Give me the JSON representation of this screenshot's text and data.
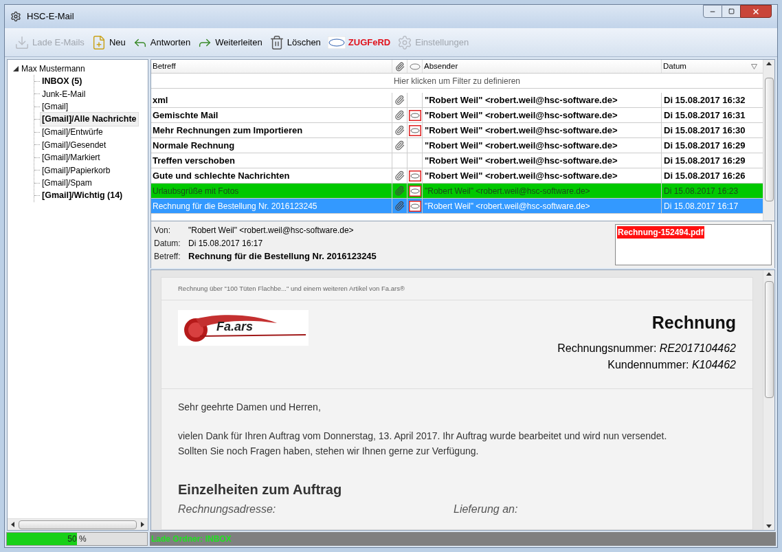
{
  "window": {
    "title": "HSC-E-Mail"
  },
  "toolbar": [
    {
      "label": "Lade E-Mails",
      "kind": "download",
      "disabled": true
    },
    {
      "label": "Neu",
      "kind": "new",
      "disabled": false
    },
    {
      "label": "Antworten",
      "kind": "reply",
      "disabled": false
    },
    {
      "label": "Weiterleiten",
      "kind": "forward",
      "disabled": false
    },
    {
      "label": "Löschen",
      "kind": "trash",
      "disabled": false
    },
    {
      "label": "ZUGFeRD",
      "kind": "ferd",
      "disabled": false
    },
    {
      "label": "Einstellungen",
      "kind": "settings",
      "disabled": true
    }
  ],
  "folders": {
    "label": "Max Mustermann",
    "expanded": true,
    "children": [
      {
        "label": "INBOX (5)",
        "bold": true,
        "selected": false
      },
      {
        "label": "Junk-E-Mail",
        "bold": false,
        "selected": false
      },
      {
        "label": "[Gmail]",
        "bold": false,
        "selected": false
      },
      {
        "label": "[Gmail]/Alle Nachrichte",
        "bold": true,
        "selected": true
      },
      {
        "label": "[Gmail]/Entwürfe",
        "bold": false,
        "selected": false
      },
      {
        "label": "[Gmail]/Gesendet",
        "bold": false,
        "selected": false
      },
      {
        "label": "[Gmail]/Markiert",
        "bold": false,
        "selected": false
      },
      {
        "label": "[Gmail]/Papierkorb",
        "bold": false,
        "selected": false
      },
      {
        "label": "[Gmail]/Spam",
        "bold": false,
        "selected": false
      },
      {
        "label": "[Gmail]/Wichtig (14)",
        "bold": true,
        "selected": false
      }
    ]
  },
  "message_list": {
    "columns": [
      "Betreff",
      "Absender",
      "Datum"
    ],
    "filter_hint": "Hier klicken um Filter zu definieren",
    "rows": [
      {
        "subject": "xml",
        "attachment": true,
        "zugferd": false,
        "sender": "\"Robert Weil\" <robert.weil@hsc-software.de>",
        "date": "Di 15.08.2017 16:32",
        "unread": true,
        "selected": false
      },
      {
        "subject": "Gemischte Mail",
        "attachment": true,
        "zugferd": true,
        "sender": "\"Robert Weil\" <robert.weil@hsc-software.de>",
        "date": "Di 15.08.2017 16:31",
        "unread": true,
        "selected": false
      },
      {
        "subject": "Mehr Rechnungen zum Importieren",
        "attachment": true,
        "zugferd": true,
        "sender": "\"Robert Weil\" <robert.weil@hsc-software.de>",
        "date": "Di 15.08.2017 16:30",
        "unread": true,
        "selected": false
      },
      {
        "subject": "Normale Rechnung",
        "attachment": true,
        "zugferd": false,
        "sender": "\"Robert Weil\" <robert.weil@hsc-software.de>",
        "date": "Di 15.08.2017 16:29",
        "unread": true,
        "selected": false
      },
      {
        "subject": "Treffen verschoben",
        "attachment": false,
        "zugferd": false,
        "sender": "\"Robert Weil\" <robert.weil@hsc-software.de>",
        "date": "Di 15.08.2017 16:29",
        "unread": true,
        "selected": false
      },
      {
        "subject": "Gute und schlechte Nachrichten",
        "attachment": true,
        "zugferd": true,
        "sender": "\"Robert Weil\" <robert.weil@hsc-software.de>",
        "date": "Di 15.08.2017 16:26",
        "unread": true,
        "selected": false
      },
      {
        "subject": "Urlaubsgrüße mit Fotos",
        "attachment": true,
        "zugferd": true,
        "sender": "\"Robert Weil\" <robert.weil@hsc-software.de>",
        "date": "Di 15.08.2017 16:23",
        "unread": false,
        "selected": false,
        "color": "#00c800"
      },
      {
        "subject": "Rechnung für die Bestellung Nr. 2016123245",
        "attachment": true,
        "zugferd": true,
        "sender": "\"Robert Weil\" <robert.weil@hsc-software.de>",
        "date": "Di 15.08.2017 16:17",
        "unread": false,
        "selected": true
      }
    ]
  },
  "preview_header": {
    "fields": [
      {
        "label": "Von:",
        "value": "\"Robert Weil\" <robert.weil@hsc-software.de>",
        "bold": false
      },
      {
        "label": "Datum:",
        "value": "Di 15.08.2017 16:17",
        "bold": false
      },
      {
        "label": "Betreff:",
        "value": "Rechnung für die Bestellung Nr. 2016123245",
        "bold": true
      }
    ],
    "attachments": [
      {
        "name": "Rechnung-152494.pdf",
        "selected": true
      }
    ]
  },
  "email_body": {
    "preheader": "Rechnung über \"100 Tüten Flachbe...\" und einem weiteren Artikel von Fa.ars®",
    "logo_text": "Fa.ars",
    "title": "Rechnung",
    "invoice_number": "Rechnungsnummer: *RE2017104462*",
    "customer_number": "Kundennummer: *K104462*",
    "greeting": "Sehr geehrte Damen und Herren,",
    "paragraph": [
      "vielen Dank für Ihren Auftrag vom Donnerstag, 13. April 2017. Ihr Auftrag wurde bearbeitet und wird nun versendet.",
      "Sollten Sie noch Fragen haben, stehen wir Ihnen gerne zur Verfügung."
    ],
    "section_heading": "Einzelheiten zum Auftrag",
    "billing_label": "Rechnungsadresse:",
    "shipping_label": "Lieferung an:"
  },
  "status_bar": {
    "progress": {
      "level": 0.5,
      "reading": "50 %"
    },
    "message": "Lade Ordner: INBOX"
  }
}
